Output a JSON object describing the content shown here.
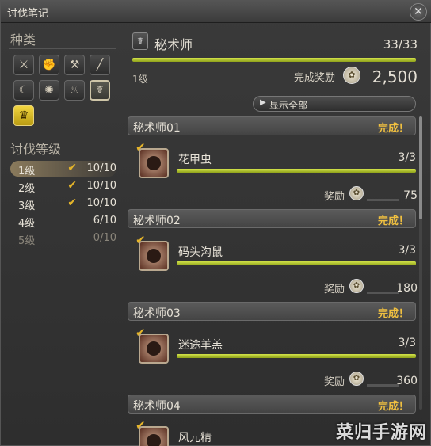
{
  "window": {
    "title": "讨伐笔记",
    "close_icon": "close-x-icon"
  },
  "left": {
    "category_title": "种类",
    "categories": [
      {
        "icon": "crossed-swords-icon",
        "glyph": "⚔",
        "selected": false,
        "gold": false
      },
      {
        "icon": "gauntlet-icon",
        "glyph": "✊",
        "selected": false,
        "gold": false
      },
      {
        "icon": "double-axe-icon",
        "glyph": "⚒",
        "selected": false,
        "gold": false
      },
      {
        "icon": "spear-icon",
        "glyph": "╱",
        "selected": false,
        "gold": false
      },
      {
        "icon": "bow-icon",
        "glyph": "☾",
        "selected": false,
        "gold": false
      },
      {
        "icon": "sparkle-icon",
        "glyph": "✺",
        "selected": false,
        "gold": false
      },
      {
        "icon": "flame-icon",
        "glyph": "♨",
        "selected": false,
        "gold": false
      },
      {
        "icon": "arcanist-book-icon",
        "glyph": "☤",
        "selected": true,
        "gold": false
      },
      {
        "icon": "grand-company-icon",
        "glyph": "♛",
        "selected": false,
        "gold": true
      }
    ],
    "level_title": "讨伐等级",
    "levels": [
      {
        "label": "1级",
        "count": "10/10",
        "done": true,
        "active": true,
        "dim": false
      },
      {
        "label": "2级",
        "count": "10/10",
        "done": true,
        "active": false,
        "dim": false
      },
      {
        "label": "3级",
        "count": "10/10",
        "done": true,
        "active": false,
        "dim": false
      },
      {
        "label": "4级",
        "count": "6/10",
        "done": false,
        "active": false,
        "dim": false
      },
      {
        "label": "5级",
        "count": "0/10",
        "done": false,
        "active": false,
        "dim": true
      }
    ]
  },
  "header": {
    "name": "秘术师",
    "count": "33/33",
    "progress": 1.0,
    "level": "1级",
    "reward_label": "完成奖励",
    "reward_value": "2,500"
  },
  "show_all_label": "显示全部",
  "groups": [
    {
      "name": "秘术师01",
      "status": "完成！",
      "mob": "花甲虫",
      "count": "3/3",
      "progress": 1.0,
      "reward_label": "奖励",
      "reward": "75"
    },
    {
      "name": "秘术师02",
      "status": "完成！",
      "mob": "码头沟鼠",
      "count": "3/3",
      "progress": 1.0,
      "reward_label": "奖励",
      "reward": "180"
    },
    {
      "name": "秘术师03",
      "status": "完成！",
      "mob": "迷途羊羔",
      "count": "3/3",
      "progress": 1.0,
      "reward_label": "奖励",
      "reward": "360"
    },
    {
      "name": "秘术师04",
      "status": "完成！",
      "mob": "风元精",
      "count": "",
      "progress": null,
      "reward_label": "",
      "reward": ""
    }
  ],
  "watermark": "菜归手游网",
  "colors": {
    "progress": "#c9db3a",
    "done": "#f0c040",
    "check": "#e5b52a"
  }
}
